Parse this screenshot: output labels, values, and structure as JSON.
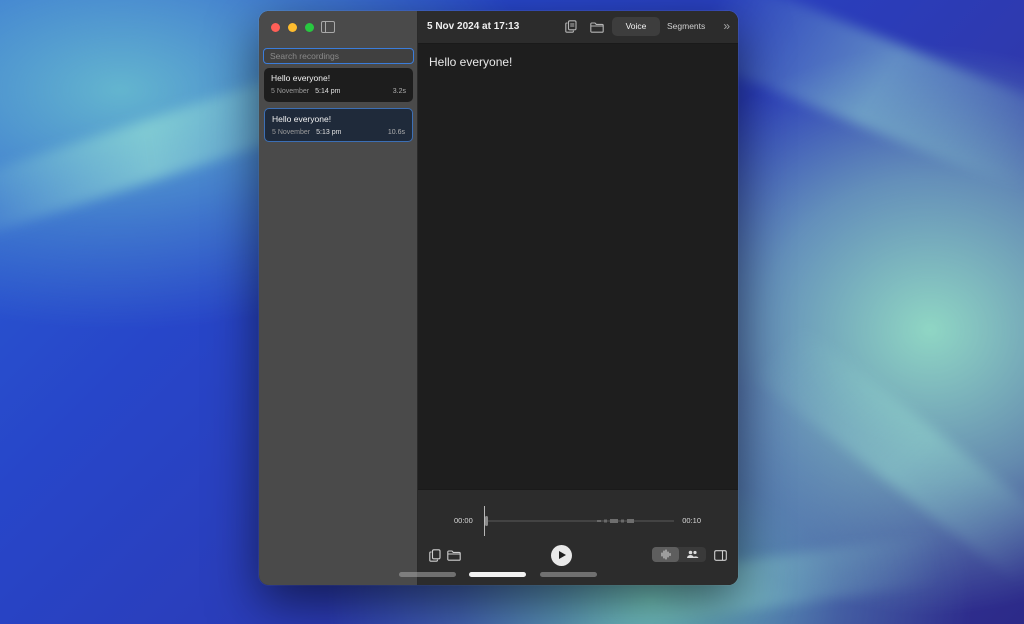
{
  "sidebar": {
    "search_placeholder": "Search recordings",
    "recordings": [
      {
        "title": "Hello everyone!",
        "date": "5 November",
        "time": "5:14 pm",
        "duration": "3.2s",
        "selected": false
      },
      {
        "title": "Hello everyone!",
        "date": "5 November",
        "time": "5:13 pm",
        "duration": "10.6s",
        "selected": true
      }
    ]
  },
  "toolbar": {
    "title": "5 Nov 2024 at 17:13",
    "tabs": [
      {
        "label": "Voice",
        "active": true
      },
      {
        "label": "Segments",
        "active": false
      }
    ],
    "icons": [
      "copy-icon",
      "folder-icon",
      "chevron-double-right-icon"
    ]
  },
  "transcript": {
    "text": "Hello everyone!"
  },
  "player": {
    "current_time": "00:00",
    "total_time": "00:10",
    "progress": 0.0,
    "icons": [
      "copy-icon",
      "folder-icon",
      "play-icon",
      "waveform-icon",
      "people-icon",
      "sidebar-right-icon"
    ]
  },
  "colors": {
    "accent": "#3b7ddb",
    "traffic_red": "#ff5f57",
    "traffic_yellow": "#febc2e",
    "traffic_green": "#28c840"
  }
}
